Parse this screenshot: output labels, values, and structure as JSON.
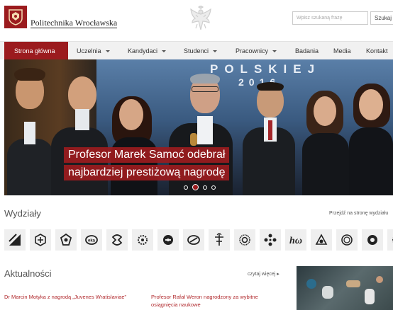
{
  "header": {
    "logo_name": "Politechnika Wrocławska",
    "search_placeholder": "Wpisz szukaną frazę",
    "search_button": "Szukaj"
  },
  "nav": {
    "items": [
      {
        "label": "Strona główna",
        "active": true
      },
      {
        "label": "Uczelnia",
        "dropdown": true
      },
      {
        "label": "Kandydaci",
        "dropdown": true
      },
      {
        "label": "Studenci",
        "dropdown": true
      },
      {
        "label": "Pracownicy",
        "dropdown": true
      },
      {
        "label": "Badania"
      },
      {
        "label": "Media"
      },
      {
        "label": "Kontakt"
      }
    ]
  },
  "hero": {
    "banner_text": "POLSKIEJ",
    "banner_year": "2016",
    "caption_line1": "Profesor Marek Samoć odebrał",
    "caption_line2": "najbardziej prestiżową nagrodę",
    "slide_count": 4,
    "active_slide": 2
  },
  "faculties": {
    "title": "Wydziały",
    "link": "Przejdź na stronę wydziału",
    "icons": [
      "architecture-icon",
      "civil-engineering-icon",
      "chemistry-icon",
      "electronics-icon",
      "geoengineering-icon",
      "environmental-icon",
      "computer-management-icon",
      "mechanical-energy-icon",
      "mechanical-icon",
      "fundamental-problems-icon",
      "electrical-icon",
      "mining-icon",
      "mathematics-icon",
      "faculty-14-icon",
      "faculty-15-icon",
      "faculty-16-icon"
    ]
  },
  "news": {
    "title": "Aktualności",
    "more_link": "czytaj więcej ▸",
    "items": [
      {
        "title": "Dr Marcin Motyka z nagrodą „Juvenes Wratislaviae”"
      },
      {
        "title": "Profesor Rafał Weron nagrodzony za wybitne osiągnięcia naukowe"
      }
    ]
  },
  "colors": {
    "brand": "#9b1b1e",
    "nav_bg": "#f1f1f1",
    "link_red": "#b0282c"
  }
}
